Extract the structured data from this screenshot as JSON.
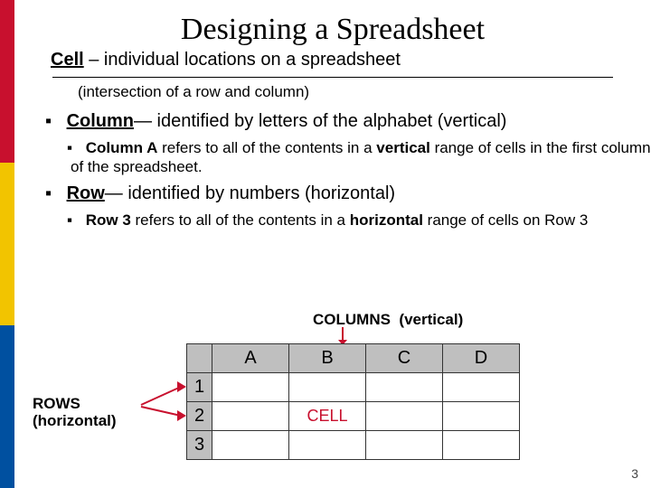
{
  "title": "Designing a Spreadsheet",
  "cell_line": {
    "term": "Cell",
    "rest": " – individual locations on a spreadsheet"
  },
  "cell_sub": "(intersection of a row and column)",
  "column_line": {
    "term": "Column",
    "rest": "— identified by letters of the alphabet (vertical)"
  },
  "column_sub": {
    "lead": "Column A",
    "mid": " refers to all of the contents in a ",
    "emph": "vertical",
    "tail": " range of cells in the first column of the spreadsheet."
  },
  "row_line": {
    "term": "Row",
    "rest": "— identified by numbers (horizontal)"
  },
  "row_sub": {
    "lead": "Row 3",
    "mid": " refers to all of the contents in a ",
    "emph": "horizontal",
    "tail": " range of cells on Row 3"
  },
  "columns_label": {
    "word": "COLUMNS",
    "paren": "(vertical)"
  },
  "rows_label": {
    "word": "ROWS",
    "paren": "(horizontal)"
  },
  "grid": {
    "cols": [
      "A",
      "B",
      "C",
      "D"
    ],
    "rows": [
      "1",
      "2",
      "3"
    ],
    "cell_text": "CELL"
  },
  "slide_number": "3"
}
